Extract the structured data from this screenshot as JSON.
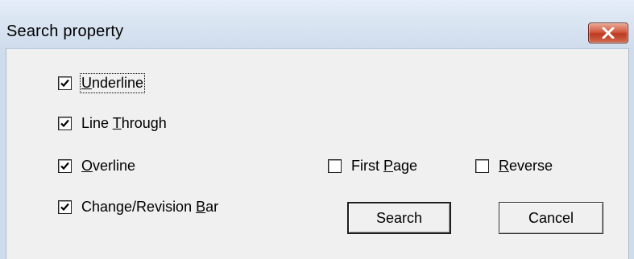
{
  "window": {
    "title": "Search property"
  },
  "options": {
    "underline": {
      "pre": "",
      "key": "U",
      "post": "nderline",
      "checked": true
    },
    "line_through": {
      "pre": "Line ",
      "key": "T",
      "post": "hrough",
      "checked": true
    },
    "overline": {
      "pre": "",
      "key": "O",
      "post": "verline",
      "checked": true
    },
    "change_bar": {
      "pre": "Change/Revision ",
      "key": "B",
      "post": "ar",
      "checked": true
    },
    "first_page": {
      "pre": "First ",
      "key": "P",
      "post": "age",
      "checked": false
    },
    "reverse": {
      "pre": "",
      "key": "R",
      "post": "everse",
      "checked": false
    }
  },
  "buttons": {
    "search": "Search",
    "cancel": "Cancel"
  }
}
